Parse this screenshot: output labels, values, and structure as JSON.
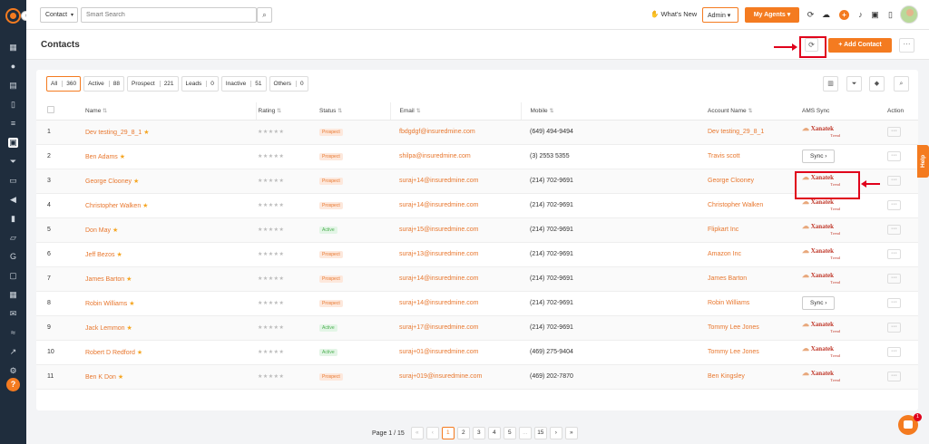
{
  "header": {
    "entity_select": "Contact",
    "search_placeholder": "Smart Search",
    "whats_new": "What's New",
    "role": "Admin",
    "agents_button": "My Agents"
  },
  "page": {
    "title": "Contacts",
    "add_contact": "Add Contact",
    "more": "···"
  },
  "filters": [
    {
      "label": "All",
      "count": "360"
    },
    {
      "label": "Active",
      "count": "88"
    },
    {
      "label": "Prospect",
      "count": "221"
    },
    {
      "label": "Leads",
      "count": "0"
    },
    {
      "label": "Inactive",
      "count": "51"
    },
    {
      "label": "Others",
      "count": "0"
    }
  ],
  "columns": {
    "name": "Name",
    "rating": "Rating",
    "status": "Status",
    "email": "Email",
    "mobile": "Mobile",
    "account": "Account Name",
    "ams": "AMS Sync",
    "action": "Action"
  },
  "ams": {
    "logo": "Xanatek",
    "sub": "Trend",
    "sync_label": "Sync"
  },
  "rows": [
    {
      "no": "1",
      "name": "Dev testing_29_8_1",
      "status": "Prospect",
      "email": "fbdgdgf@insuredmine.com",
      "mobile": "(649) 494-9494",
      "account": "Dev testing_29_8_1",
      "ams": "logo"
    },
    {
      "no": "2",
      "name": "Ben Adams",
      "status": "Prospect",
      "email": "shilpa@insuredmine.com",
      "mobile": "(3) 2553 5355",
      "account": "Travis scott",
      "ams": "sync"
    },
    {
      "no": "3",
      "name": "George Clooney",
      "status": "Prospect",
      "email": "suraj+14@insuredmine.com",
      "mobile": "(214) 702-9691",
      "account": "George Clooney",
      "ams": "logo"
    },
    {
      "no": "4",
      "name": "Christopher Walken",
      "status": "Prospect",
      "email": "suraj+14@insuredmine.com",
      "mobile": "(214) 702-9691",
      "account": "Christopher Walken",
      "ams": "logo"
    },
    {
      "no": "5",
      "name": "Don May",
      "status": "Active",
      "email": "suraj+15@insuredmine.com",
      "mobile": "(214) 702-9691",
      "account": "Flipkart Inc",
      "ams": "logo"
    },
    {
      "no": "6",
      "name": "Jeff Bezos",
      "status": "Prospect",
      "email": "suraj+13@insuredmine.com",
      "mobile": "(214) 702-9691",
      "account": "Amazon Inc",
      "ams": "logo"
    },
    {
      "no": "7",
      "name": "James Barton",
      "status": "Prospect",
      "email": "suraj+14@insuredmine.com",
      "mobile": "(214) 702-9691",
      "account": "James Barton",
      "ams": "logo"
    },
    {
      "no": "8",
      "name": "Robin Williams",
      "status": "Prospect",
      "email": "suraj+14@insuredmine.com",
      "mobile": "(214) 702-9691",
      "account": "Robin Williams",
      "ams": "sync"
    },
    {
      "no": "9",
      "name": "Jack Lemmon",
      "status": "Active",
      "email": "suraj+17@insuredmine.com",
      "mobile": "(214) 702-9691",
      "account": "Tommy Lee Jones",
      "ams": "logo"
    },
    {
      "no": "10",
      "name": "Robert D Redford",
      "status": "Active",
      "email": "suraj+01@insuredmine.com",
      "mobile": "(469) 275-9404",
      "account": "Tommy Lee Jones",
      "ams": "logo"
    },
    {
      "no": "11",
      "name": "Ben K Don",
      "status": "Prospect",
      "email": "suraj+019@insuredmine.com",
      "mobile": "(469) 202-7870",
      "account": "Ben Kingsley",
      "ams": "logo"
    }
  ],
  "pagination": {
    "label": "Page 1 / 15",
    "first": "«",
    "prev": "‹",
    "pages": [
      "1",
      "2",
      "3",
      "4",
      "5",
      "...",
      "15"
    ],
    "next": "›",
    "last": "»"
  },
  "help_tab": "Help",
  "chat_badge": "1",
  "colors": {
    "accent": "#f47b20",
    "sidebar": "#1f2d3d",
    "annotation": "#e0001b"
  }
}
